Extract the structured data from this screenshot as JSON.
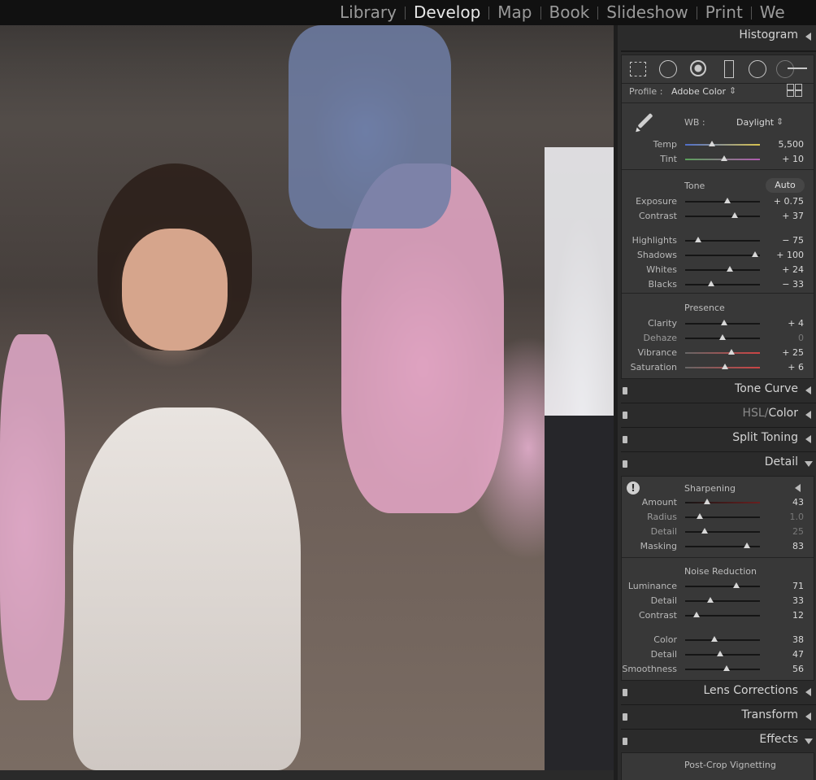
{
  "modules": {
    "items": [
      "Library",
      "Develop",
      "Map",
      "Book",
      "Slideshow",
      "Print",
      "We"
    ],
    "active": "Develop"
  },
  "panels": {
    "histogram": "Histogram",
    "tone_curve": "Tone Curve",
    "hsl": "HSL",
    "hsl_sep": "/",
    "color": "Color",
    "split_toning": "Split Toning",
    "detail": "Detail",
    "lens_corrections": "Lens Corrections",
    "transform": "Transform",
    "effects": "Effects",
    "post_crop_vignetting": "Post-Crop Vignetting"
  },
  "basic": {
    "profile_label": "Profile :",
    "profile_value": "Adobe Color",
    "wb_label": "WB :",
    "wb_value": "Daylight",
    "tone_label": "Tone",
    "auto_label": "Auto",
    "presence_label": "Presence",
    "wb_sliders": [
      {
        "label": "Temp",
        "value": "5,500",
        "pos": 0.36
      },
      {
        "label": "Tint",
        "value": "+ 10",
        "pos": 0.52
      }
    ],
    "tone_sliders_a": [
      {
        "label": "Exposure",
        "value": "+ 0.75",
        "pos": 0.56
      },
      {
        "label": "Contrast",
        "value": "+ 37",
        "pos": 0.66
      }
    ],
    "tone_sliders_b": [
      {
        "label": "Highlights",
        "value": "− 75",
        "pos": 0.17
      },
      {
        "label": "Shadows",
        "value": "+ 100",
        "pos": 0.94
      },
      {
        "label": "Whites",
        "value": "+ 24",
        "pos": 0.6
      },
      {
        "label": "Blacks",
        "value": "− 33",
        "pos": 0.35
      }
    ],
    "presence_sliders": [
      {
        "label": "Clarity",
        "value": "+ 4",
        "pos": 0.52
      },
      {
        "label": "Dehaze",
        "value": "0",
        "pos": 0.5,
        "dim": true
      },
      {
        "label": "Vibrance",
        "value": "+ 25",
        "pos": 0.62
      },
      {
        "label": "Saturation",
        "value": "+ 6",
        "pos": 0.53
      }
    ]
  },
  "detail": {
    "sharpening_label": "Sharpening",
    "noise_reduction_label": "Noise Reduction",
    "sharpening_sliders": [
      {
        "label": "Amount",
        "value": "43",
        "pos": 0.29
      },
      {
        "label": "Radius",
        "value": "1.0",
        "pos": 0.2,
        "dim": true
      },
      {
        "label": "Detail",
        "value": "25",
        "pos": 0.26,
        "dim": true
      },
      {
        "label": "Masking",
        "value": "83",
        "pos": 0.83
      }
    ],
    "noise_sliders_a": [
      {
        "label": "Luminance",
        "value": "71",
        "pos": 0.69
      },
      {
        "label": "Detail",
        "value": "33",
        "pos": 0.34
      },
      {
        "label": "Contrast",
        "value": "12",
        "pos": 0.15
      }
    ],
    "noise_sliders_b": [
      {
        "label": "Color",
        "value": "38",
        "pos": 0.39
      },
      {
        "label": "Detail",
        "value": "47",
        "pos": 0.47
      },
      {
        "label": "Smoothness",
        "value": "56",
        "pos": 0.55
      }
    ]
  },
  "colors": {
    "panel_bg": "#2b2b2b",
    "section_bg": "#383838",
    "text": "#d4d4d4"
  }
}
